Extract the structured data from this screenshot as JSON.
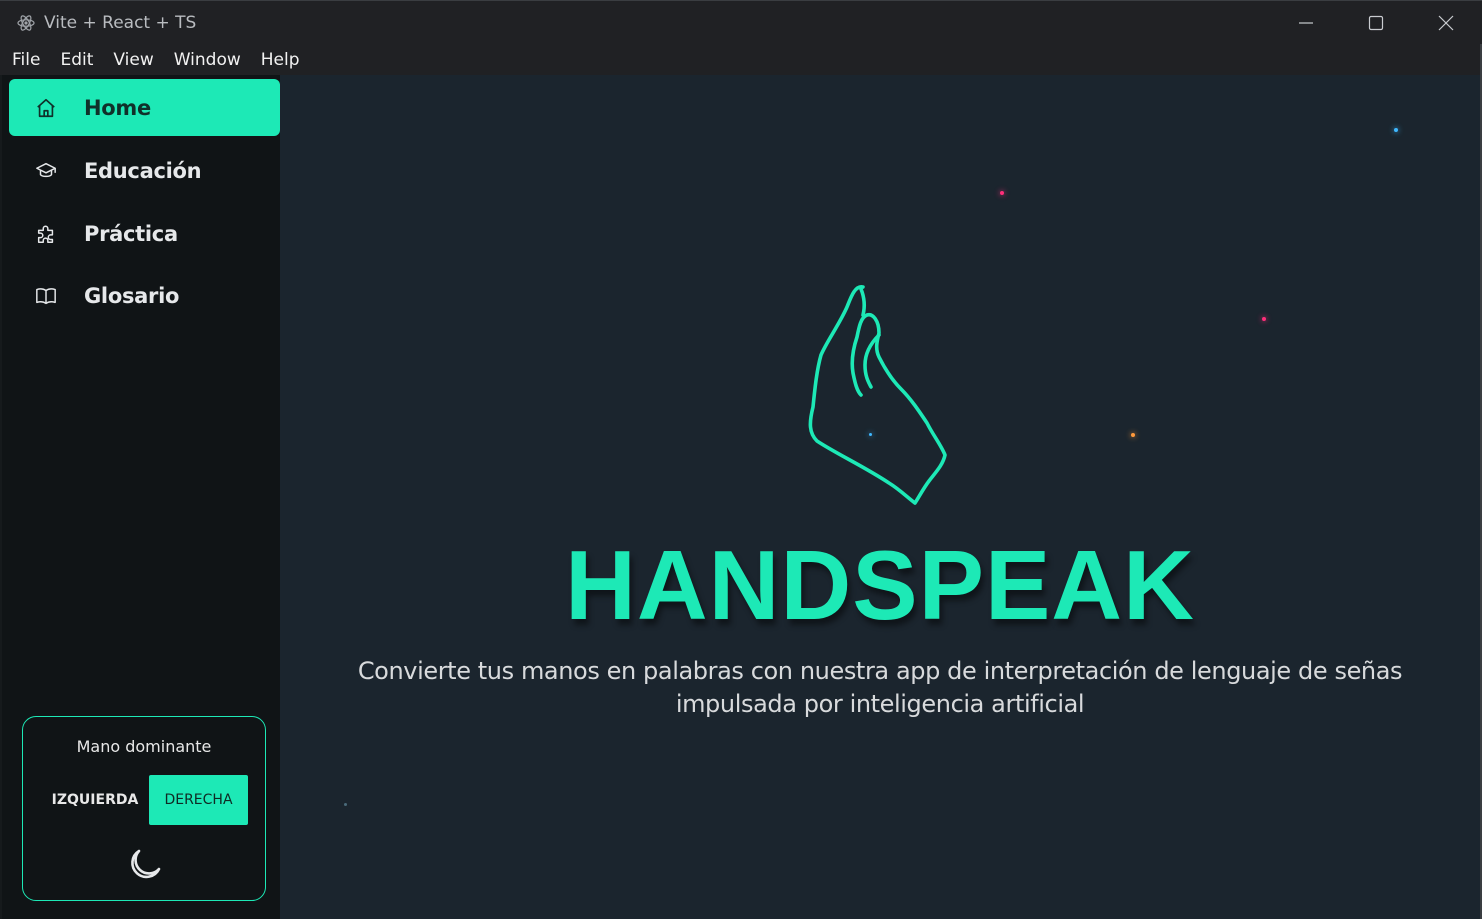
{
  "window": {
    "title": "Vite + React + TS",
    "controls": [
      "minimize-icon",
      "maximize-icon",
      "close-icon"
    ]
  },
  "menubar": {
    "items": [
      "File",
      "Edit",
      "View",
      "Window",
      "Help"
    ]
  },
  "sidebar": {
    "items": [
      {
        "label": "Home",
        "icon": "home-icon",
        "active": true
      },
      {
        "label": "Educación",
        "icon": "graduation-cap-icon",
        "active": false
      },
      {
        "label": "Práctica",
        "icon": "puzzle-icon",
        "active": false
      },
      {
        "label": "Glosario",
        "icon": "book-icon",
        "active": false
      }
    ],
    "dominant_hand": {
      "title": "Mano dominante",
      "left_label": "IZQUIERDA",
      "right_label": "DERECHA",
      "selected": "DERECHA",
      "theme_icon": "moon-icon"
    }
  },
  "main": {
    "brand": "HANDSPEAK",
    "tagline": "Convierte tus manos en palabras con nuestra app de interpretación de lenguaje de señas impulsada por inteligencia artificial",
    "logo_icon": "hand-sign-icon"
  },
  "colors": {
    "accent": "#1de9b6",
    "sidebar_bg": "#101416",
    "main_bg": "#1b252e",
    "titlebar_bg": "#202124"
  }
}
